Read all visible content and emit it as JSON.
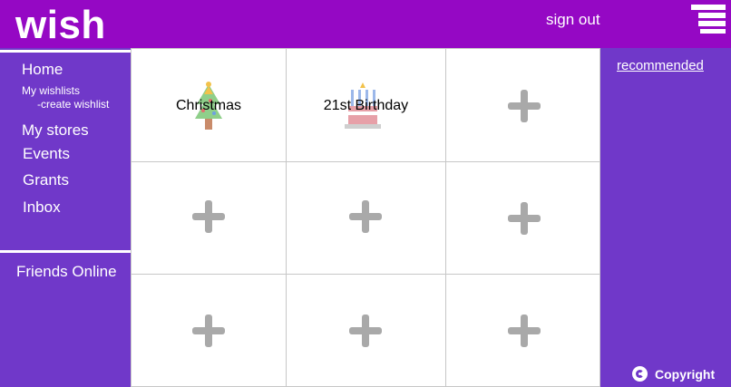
{
  "header": {
    "logo": "wish",
    "sign_out": "sign out",
    "menu_icon": "hamburger-icon",
    "background": "#9508c4"
  },
  "sidebar": {
    "background": "#7038c9",
    "items": [
      {
        "label": "Home"
      },
      {
        "label": "My wishlists"
      },
      {
        "label": "-create wishlist"
      },
      {
        "label": "My stores"
      },
      {
        "label": "Events"
      },
      {
        "label": "Grants"
      },
      {
        "label": "Inbox"
      }
    ],
    "friends_online": "Friends Online"
  },
  "wishlists": [
    {
      "title": "Christmas",
      "icon": "christmas-tree-icon"
    },
    {
      "title": "21st Birthday",
      "icon": "birthday-cake-icon"
    },
    {
      "empty": true,
      "icon": "plus-icon"
    },
    {
      "empty": true,
      "icon": "plus-icon"
    },
    {
      "empty": true,
      "icon": "plus-icon"
    },
    {
      "empty": true,
      "icon": "plus-icon"
    },
    {
      "empty": true,
      "icon": "plus-icon"
    },
    {
      "empty": true,
      "icon": "plus-icon"
    },
    {
      "empty": true,
      "icon": "plus-icon"
    }
  ],
  "rightbar": {
    "recommended": "recommended",
    "copyright": "Copyright",
    "copyright_icon": "copyright-icon"
  }
}
